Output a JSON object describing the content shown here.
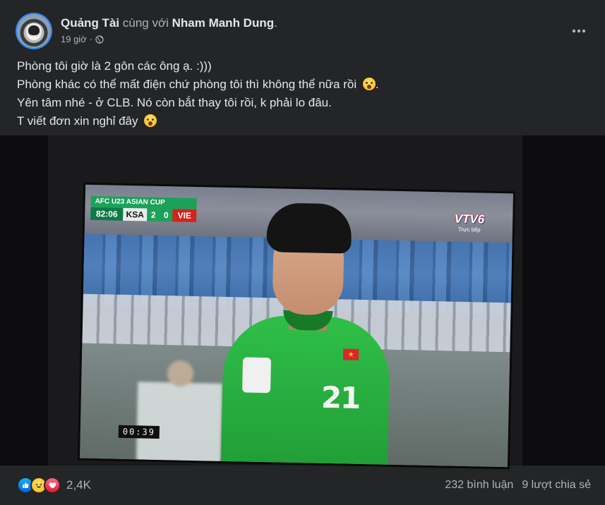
{
  "post": {
    "author": "Quảng Tài",
    "with_text": "cùng với",
    "tagged": "Nham Manh Dung",
    "period": ".",
    "time": "19 giờ",
    "separator": "·",
    "privacy_icon": "globe-icon",
    "menu_icon": "more-horizontal-icon",
    "lines": [
      "Phòng tôi giờ là 2 gôn các ông ạ. :)))",
      "Phòng khác có thể mất điện chứ phòng tôi thì không thể nữa rồi",
      "Yên tâm nhé - ở CLB. Nó còn bắt thay tôi rồi, k phải lo đâu.",
      "T viết đơn xin nghỉ đây"
    ]
  },
  "photo": {
    "scorebug": {
      "competition": "AFC U23 ASIAN CUP",
      "clock": "82:06",
      "team_home": "KSA",
      "score_home": "2",
      "score_away": "0",
      "team_away": "VIE"
    },
    "broadcaster": "VTV6",
    "broadcaster_sub": "Trực tiếp",
    "jersey_number": "21",
    "player_clock": "00:39"
  },
  "footer": {
    "reaction_icons": [
      "like-icon",
      "haha-icon",
      "love-icon"
    ],
    "reaction_count": "2,4K",
    "comments": "232 bình luận",
    "shares": "9 lượt chia sẻ"
  },
  "colors": {
    "card_bg": "#242526",
    "text_primary": "#e4e6eb",
    "text_secondary": "#b0b3b8",
    "like_blue": "#0062df",
    "love_red": "#e61739"
  }
}
